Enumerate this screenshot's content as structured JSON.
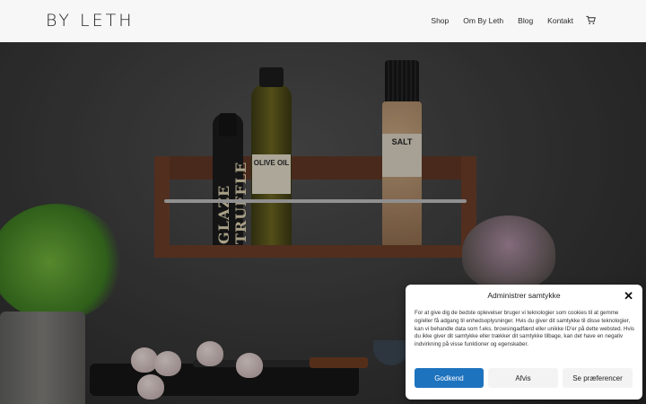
{
  "header": {
    "logo": "BY LETH",
    "nav": [
      "Shop",
      "Om By Leth",
      "Blog",
      "Kontakt"
    ],
    "cart_icon": "cart-icon"
  },
  "hero": {
    "glaze_label": "GLAZE TRUFFLE",
    "oil_label": "OLIVE OIL",
    "salt_label": "SALT"
  },
  "cookie": {
    "title": "Administrer samtykke",
    "text": "For at give dig de bedste oplevelser bruger vi teknologier som cookies til at gemme og/eller få adgang til enhedsoplysninger. Hvis du giver dit samtykke til disse teknologier, kan vi behandle data som f.eks. browsingadfærd eller unikke ID'er på dette websted. Hvis du ikke giver dit samtykke eller trækker dit samtykke tilbage, kan det have en negativ indvirkning på visse funktioner og egenskaber.",
    "accept": "Godkend",
    "deny": "Afvis",
    "preferences": "Se præferencer",
    "accent_color": "#1e73be"
  }
}
